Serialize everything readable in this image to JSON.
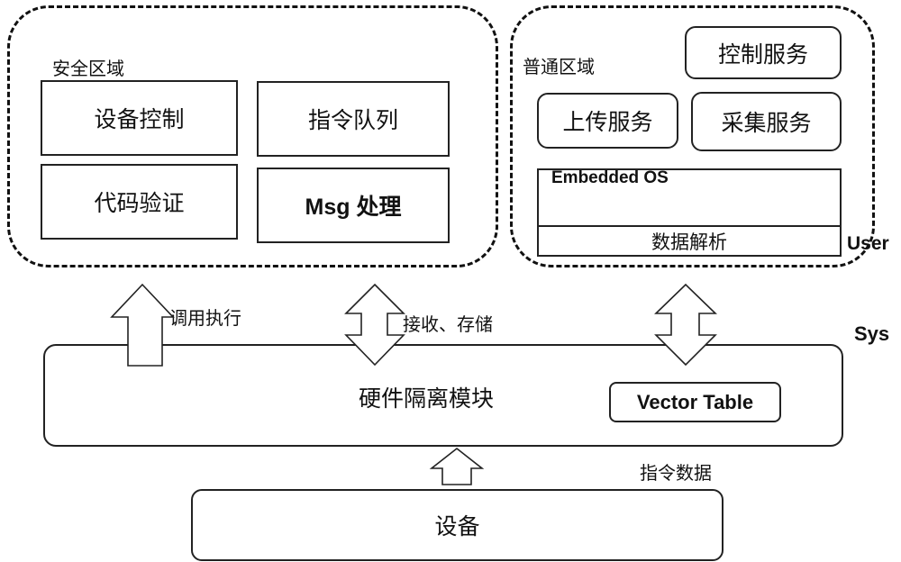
{
  "secure_zone": {
    "title": "安全区域",
    "modules": [
      {
        "label": "设备控制"
      },
      {
        "label": "指令队列"
      },
      {
        "label": "代码验证"
      },
      {
        "label": "Msg 处理"
      }
    ]
  },
  "normal_zone": {
    "title": "普通区域",
    "services": [
      {
        "label": "控制服务"
      },
      {
        "label": "上传服务"
      },
      {
        "label": "采集服务"
      }
    ],
    "os_label": "Embedded OS",
    "parser_label": "数据解析",
    "level_label": "User"
  },
  "hardware": {
    "label": "硬件隔离模块",
    "vector_table": "Vector Table",
    "level_label": "Sys"
  },
  "device": {
    "label": "设备"
  },
  "arrows": {
    "invoke_label": "调用执行",
    "store_label": "接收、存储",
    "command_label": "指令数据"
  }
}
